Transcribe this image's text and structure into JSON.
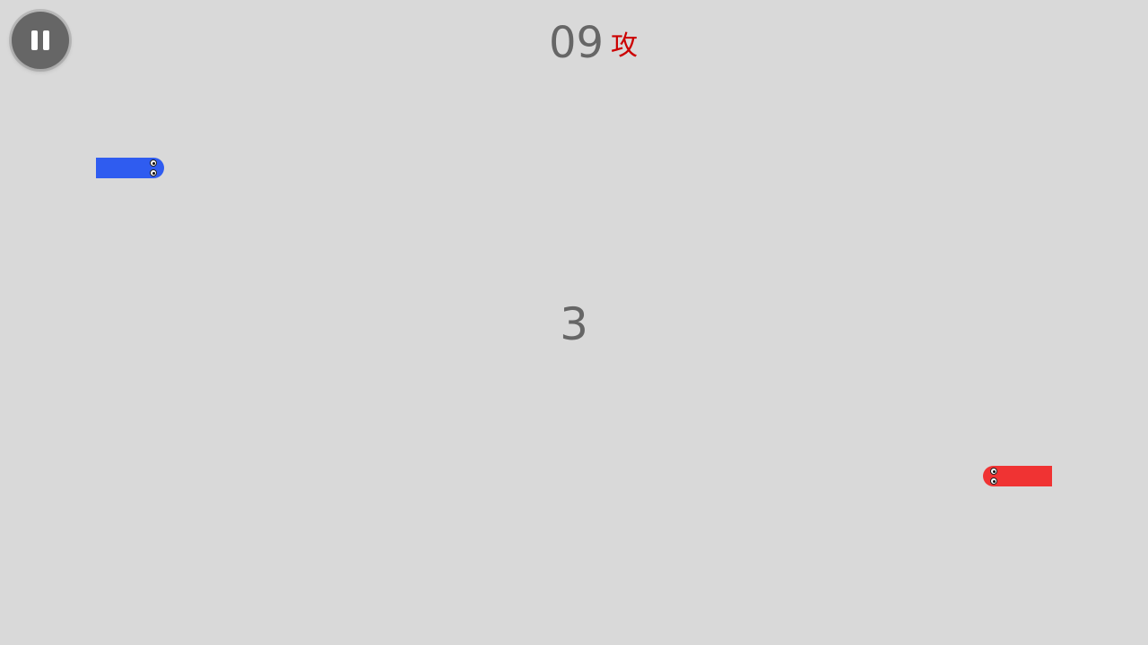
{
  "hud": {
    "timer": "09",
    "mode_label": "攻",
    "mode_color": "#cc0000"
  },
  "countdown": "3",
  "controls": {
    "pause_icon": "pause-icon"
  },
  "players": [
    {
      "name": "blue-snake",
      "color": "#2f5cf0",
      "facing": "right"
    },
    {
      "name": "red-snake",
      "color": "#f03333",
      "facing": "left"
    }
  ]
}
